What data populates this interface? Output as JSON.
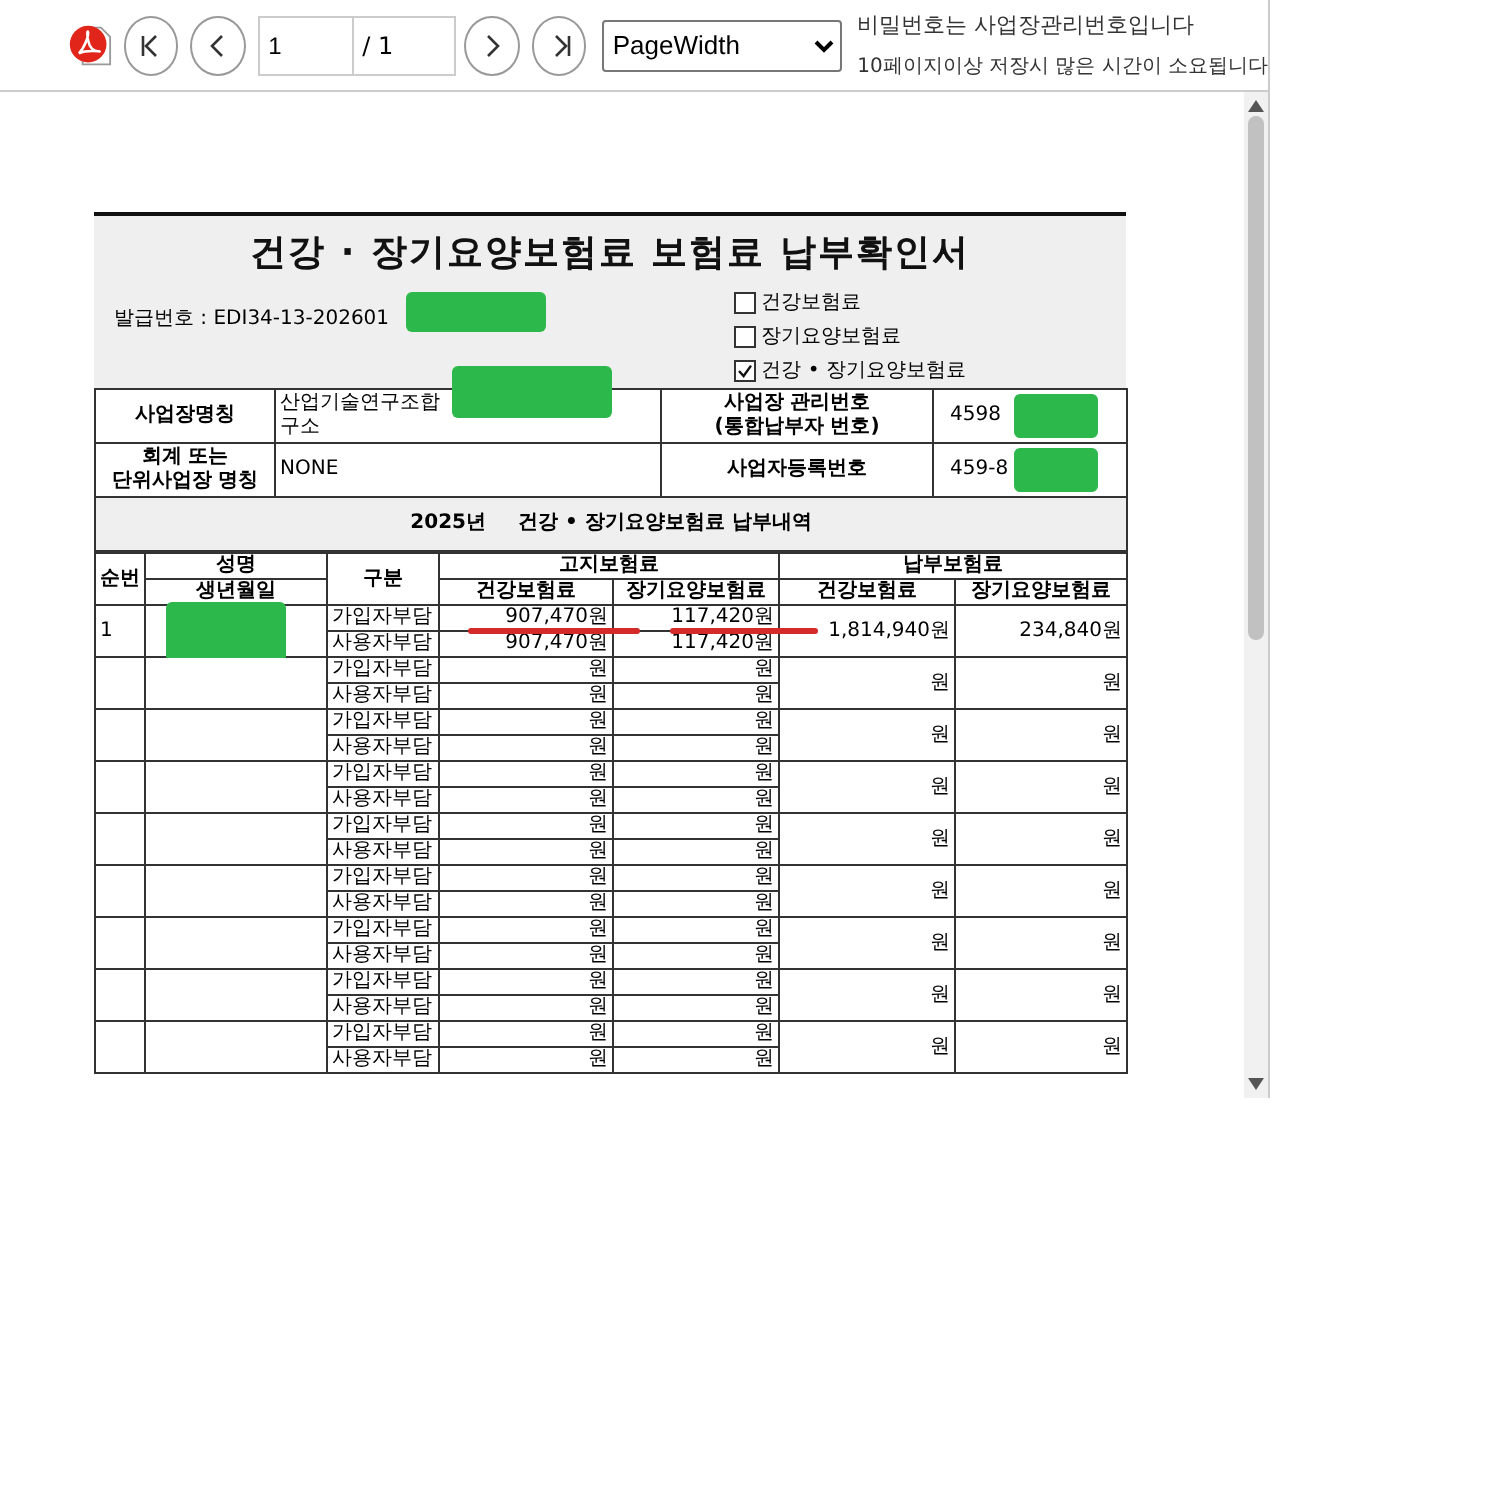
{
  "toolbar": {
    "page": "1",
    "page_total": "/ 1",
    "zoom": "PageWidth",
    "notices": [
      "비밀번호는 사업장관리번호입니다",
      "10페이지이상 저장시 많은 시간이 소요됩니다"
    ]
  },
  "document": {
    "title": "건강 · 장기요양보험료 보험료 납부확인서",
    "issue_number": "발급번호 : EDI34-13-202601",
    "issue_redacted": true,
    "options": [
      {
        "label": "건강보험료",
        "checked": false
      },
      {
        "label": "장기요양보험료",
        "checked": false
      },
      {
        "label": "건강 • 장기요양보험료",
        "checked": true
      }
    ],
    "info_rows": [
      {
        "label": [
          "사업장명칭"
        ],
        "value": [
          "산업기술연구조합",
          "구소"
        ],
        "value_redacted": true,
        "label_2": [
          "사업장 관리번호",
          "(통합납부자 번호)"
        ],
        "value_2": "4598",
        "value_2_redacted": true
      },
      {
        "label": [
          "회계 또는",
          "단위사업장 명칭"
        ],
        "value": [
          "NONE"
        ],
        "label_2": [
          "사업자등록번호"
        ],
        "value_2": "459-8",
        "value_2_redacted": true
      }
    ],
    "summary_year": "2025년",
    "summary_title": "건강 • 장기요양보험료 납부내역",
    "header": {
      "seq": "순번",
      "name": "성명",
      "birth": "생년월일",
      "type": "구분",
      "billed": "고지보험료",
      "paid": "납부보험료",
      "sub": [
        "건강보험료",
        "장기요양보험료",
        "건강보험료",
        "장기요양보험료"
      ]
    },
    "rows": [
      {
        "seq": "1",
        "redacted": true,
        "marked": true,
        "lines": [
          {
            "type": "가입자부담",
            "health": "907,470원",
            "longterm": "117,420원"
          },
          {
            "type": "사용자부담",
            "health": "907,470원",
            "longterm": "117,420원"
          }
        ],
        "paid_health": "1,814,940원",
        "paid_longterm": "234,840원"
      },
      {
        "lines": [
          {
            "type": "가입자부담",
            "health": "원",
            "longterm": "원"
          },
          {
            "type": "사용자부담",
            "health": "원",
            "longterm": "원"
          }
        ],
        "paid_health": "원",
        "paid_longterm": "원"
      },
      {
        "lines": [
          {
            "type": "가입자부담",
            "health": "원",
            "longterm": "원"
          },
          {
            "type": "사용자부담",
            "health": "원",
            "longterm": "원"
          }
        ],
        "paid_health": "원",
        "paid_longterm": "원"
      },
      {
        "lines": [
          {
            "type": "가입자부담",
            "health": "원",
            "longterm": "원"
          },
          {
            "type": "사용자부담",
            "health": "원",
            "longterm": "원"
          }
        ],
        "paid_health": "원",
        "paid_longterm": "원"
      },
      {
        "lines": [
          {
            "type": "가입자부담",
            "health": "원",
            "longterm": "원"
          },
          {
            "type": "사용자부담",
            "health": "원",
            "longterm": "원"
          }
        ],
        "paid_health": "원",
        "paid_longterm": "원"
      },
      {
        "lines": [
          {
            "type": "가입자부담",
            "health": "원",
            "longterm": "원"
          },
          {
            "type": "사용자부담",
            "health": "원",
            "longterm": "원"
          }
        ],
        "paid_health": "원",
        "paid_longterm": "원"
      },
      {
        "lines": [
          {
            "type": "가입자부담",
            "health": "원",
            "longterm": "원"
          },
          {
            "type": "사용자부담",
            "health": "원",
            "longterm": "원"
          }
        ],
        "paid_health": "원",
        "paid_longterm": "원"
      },
      {
        "lines": [
          {
            "type": "가입자부담",
            "health": "원",
            "longterm": "원"
          },
          {
            "type": "사용자부담",
            "health": "원",
            "longterm": "원"
          }
        ],
        "paid_health": "원",
        "paid_longterm": "원"
      },
      {
        "lines": [
          {
            "type": "가입자부담",
            "health": "원",
            "longterm": "원"
          },
          {
            "type": "사용자부담",
            "health": "원",
            "longterm": "원"
          }
        ],
        "paid_health": "원",
        "paid_longterm": "원"
      }
    ]
  }
}
